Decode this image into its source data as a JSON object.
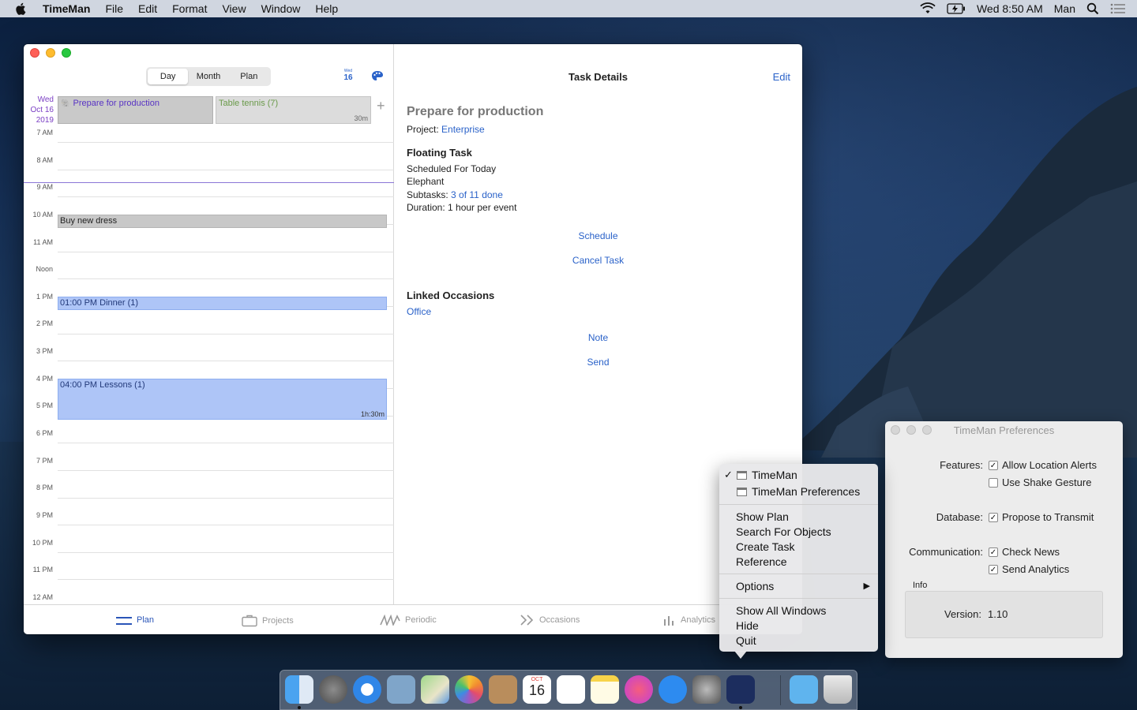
{
  "menubar": {
    "app_name": "TimeMan",
    "menus": [
      "File",
      "Edit",
      "Format",
      "View",
      "Window",
      "Help"
    ],
    "clock": "Wed 8:50 AM",
    "user": "Man"
  },
  "main_window": {
    "segments": [
      "Day",
      "Month",
      "Plan"
    ],
    "active_segment": "Day",
    "mini_calendar": {
      "weekday": "Wed",
      "day": "16"
    },
    "date_header": {
      "weekday": "Wed",
      "month_day": "Oct 16",
      "year": "2019"
    },
    "all_day": [
      {
        "title": "Prepare for production"
      },
      {
        "title": "Table tennis (7)",
        "duration": "30m"
      }
    ],
    "hours": [
      "7 AM",
      "8 AM",
      "9 AM",
      "10 AM",
      "11 AM",
      "Noon",
      "1 PM",
      "2 PM",
      "3 PM",
      "4 PM",
      "5 PM",
      "6 PM",
      "7 PM",
      "8 PM",
      "9 PM",
      "10 PM",
      "11 PM",
      "12 AM"
    ],
    "events": [
      {
        "title": "Buy new dress"
      },
      {
        "title": "01:00 PM Dinner (1)"
      },
      {
        "title": "04:00 PM Lessons (1)",
        "duration": "1h:30m"
      }
    ],
    "task_details": {
      "header": "Task Details",
      "edit": "Edit",
      "name": "Prepare for production",
      "project_label": "Project:",
      "project": "Enterprise",
      "section": "Floating Task",
      "scheduled": "Scheduled For Today",
      "tag": "Elephant",
      "subtasks_label": "Subtasks:",
      "subtasks": "3 of 11 done",
      "duration": "Duration: 1 hour per event",
      "schedule_btn": "Schedule",
      "cancel_btn": "Cancel Task",
      "linked_header": "Linked Occasions",
      "linked_item": "Office",
      "note_btn": "Note",
      "send_btn": "Send"
    },
    "tabs": [
      "Plan",
      "Projects",
      "Periodic",
      "Occasions",
      "Analytics"
    ],
    "active_tab": "Plan"
  },
  "dock_menu": {
    "windows": [
      "TimeMan",
      "TimeMan Preferences"
    ],
    "checked": "TimeMan",
    "group1": [
      "Show Plan",
      "Search For Objects",
      "Create Task",
      "Reference"
    ],
    "options": "Options",
    "group3": [
      "Show All Windows",
      "Hide",
      "Quit"
    ]
  },
  "preferences": {
    "title": "TimeMan Preferences",
    "features_label": "Features:",
    "allow_location": "Allow Location Alerts",
    "allow_location_checked": true,
    "shake_gesture": "Use Shake Gesture",
    "shake_gesture_checked": false,
    "database_label": "Database:",
    "propose": "Propose to Transmit",
    "propose_checked": true,
    "communication_label": "Communication:",
    "check_news": "Check News",
    "check_news_checked": true,
    "send_analytics": "Send Analytics",
    "send_analytics_checked": true,
    "info_label": "Info",
    "version_label": "Version:",
    "version": "1.10"
  },
  "colors": {
    "accent": "#2a62c9",
    "event_blue": "#aec5f7",
    "purple": "#7b3fc4"
  },
  "dock": {
    "apps": [
      "finder-icon",
      "launchpad-icon",
      "safari-icon",
      "mail-icon",
      "maps-icon",
      "photos-icon",
      "contacts-icon",
      "calendar-icon",
      "reminders-icon",
      "notes-icon",
      "music-icon",
      "app-store-icon",
      "system-preferences-icon",
      "timeman-icon"
    ],
    "calendar_month": "OCT",
    "calendar_day": "16"
  }
}
